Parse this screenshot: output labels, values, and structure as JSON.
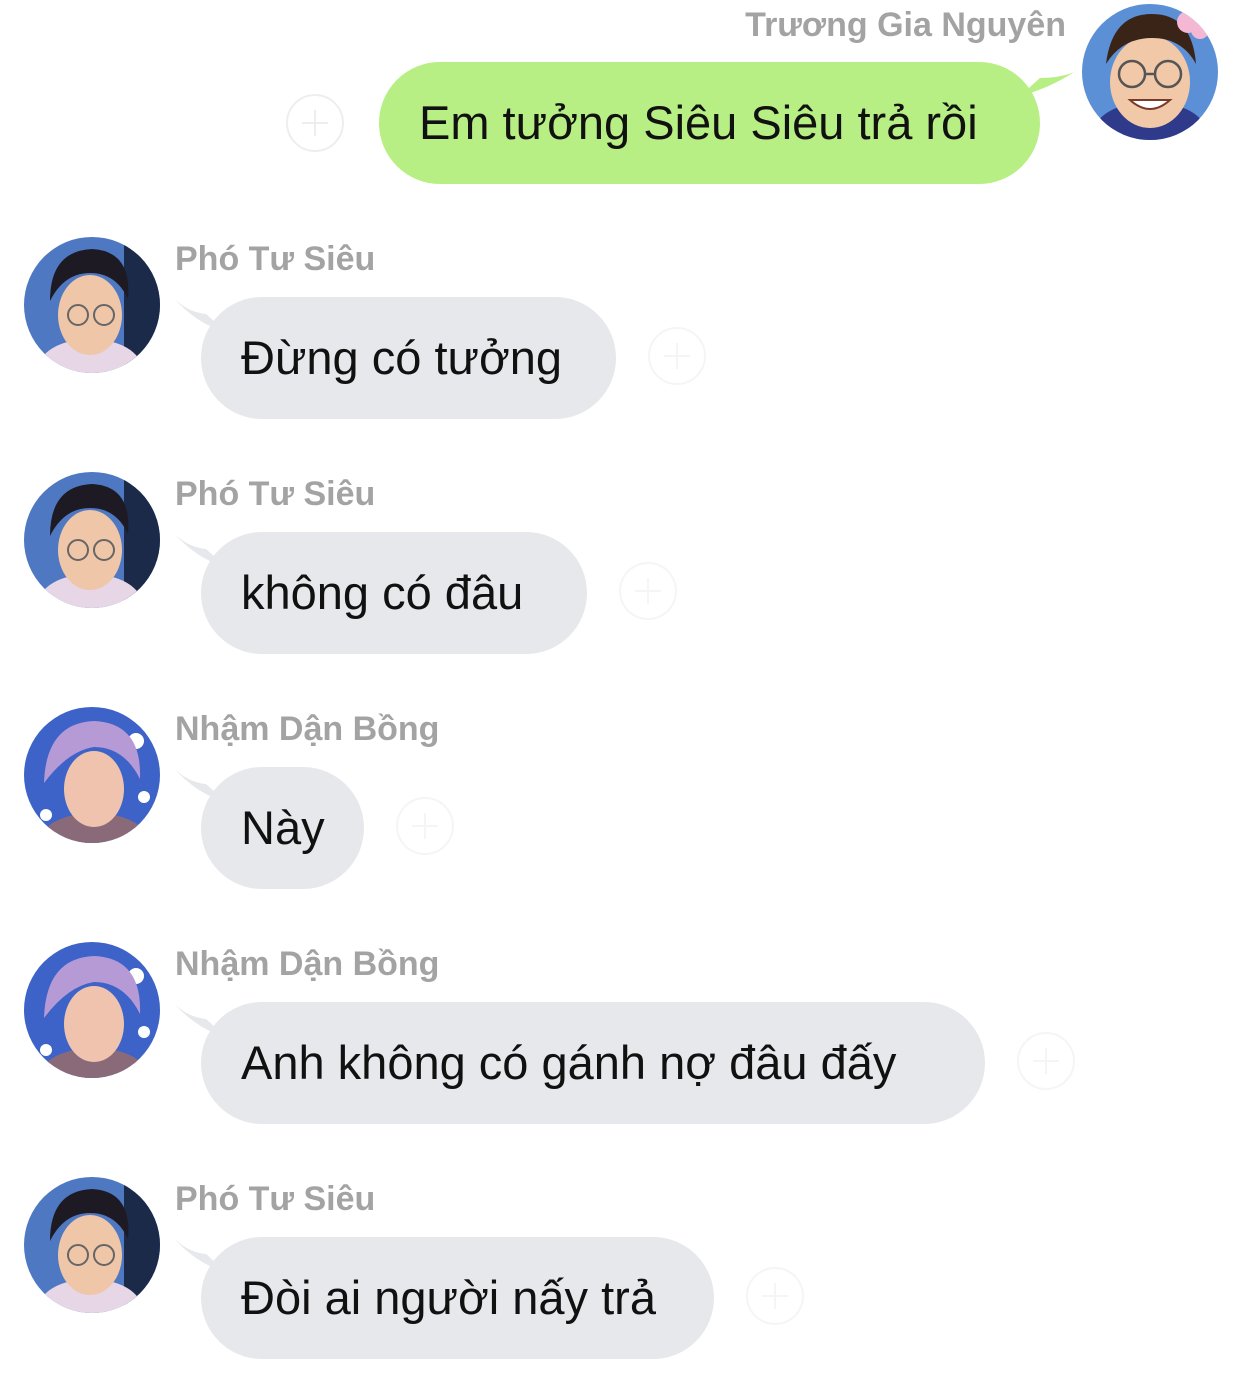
{
  "messages": [
    {
      "sender": "Trương Gia Nguyên",
      "text": "Em tưởng Siêu Siêu trả rồi",
      "direction": "outgoing",
      "avatar": "smiling-boy-avatar"
    },
    {
      "sender": "Phó Tư Siêu",
      "text": "Đừng có tưởng",
      "direction": "incoming",
      "avatar": "dark-hair-avatar"
    },
    {
      "sender": "Phó Tư Siêu",
      "text": "không có đâu",
      "direction": "incoming",
      "avatar": "dark-hair-avatar"
    },
    {
      "sender": "Nhậm Dận Bồng",
      "text": "Này",
      "direction": "incoming",
      "avatar": "purple-hair-avatar"
    },
    {
      "sender": "Nhậm Dận Bồng",
      "text": "Anh không có gánh nợ đâu đấy",
      "direction": "incoming",
      "avatar": "purple-hair-avatar"
    },
    {
      "sender": "Phó Tư Siêu",
      "text": "Đòi ai người nấy trả",
      "direction": "incoming",
      "avatar": "dark-hair-avatar"
    }
  ],
  "colors": {
    "outgoing_bubble": "#b7ef85",
    "incoming_bubble": "#e6e8ec",
    "sender_name": "#a3a3a3"
  },
  "icons": {
    "reaction": "add-reaction-icon"
  }
}
